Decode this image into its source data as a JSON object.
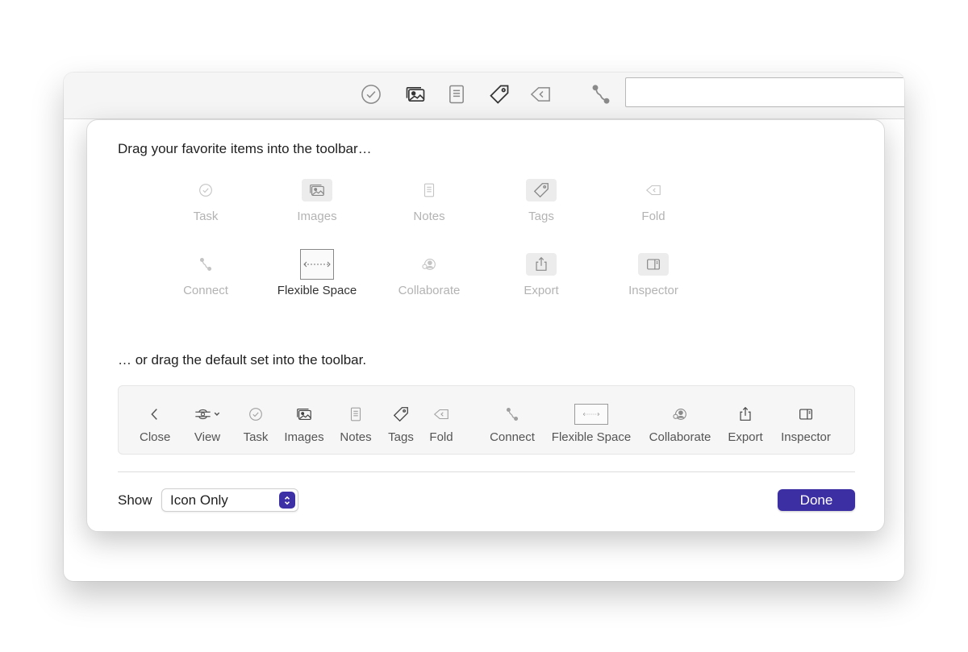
{
  "toolbar": {
    "icons": [
      "task-icon",
      "images-icon",
      "notes-icon",
      "tags-icon",
      "fold-icon",
      "connect-icon"
    ],
    "search_value": ""
  },
  "sheet": {
    "instruction_top": "Drag your favorite items into the toolbar…",
    "instruction_bottom": "… or drag the default set into the toolbar.",
    "palette": [
      {
        "label": "Task",
        "icon": "task-icon"
      },
      {
        "label": "Images",
        "icon": "images-icon"
      },
      {
        "label": "Notes",
        "icon": "notes-icon"
      },
      {
        "label": "Tags",
        "icon": "tags-icon"
      },
      {
        "label": "Fold",
        "icon": "fold-icon"
      },
      {
        "label": "Connect",
        "icon": "connect-icon"
      },
      {
        "label": "Flexible Space",
        "icon": "flexible-space-icon"
      },
      {
        "label": "Collaborate",
        "icon": "collaborate-icon"
      },
      {
        "label": "Export",
        "icon": "export-icon"
      },
      {
        "label": "Inspector",
        "icon": "inspector-icon"
      }
    ],
    "default_set": [
      {
        "label": "Close",
        "icon": "chevron-left-icon"
      },
      {
        "label": "View",
        "icon": "view-icon"
      },
      {
        "label": "Task",
        "icon": "task-icon"
      },
      {
        "label": "Images",
        "icon": "images-icon"
      },
      {
        "label": "Notes",
        "icon": "notes-icon"
      },
      {
        "label": "Tags",
        "icon": "tags-icon"
      },
      {
        "label": "Fold",
        "icon": "fold-icon"
      },
      {
        "label": "Connect",
        "icon": "connect-icon"
      },
      {
        "label": "Flexible Space",
        "icon": "flexible-space-icon"
      },
      {
        "label": "Collaborate",
        "icon": "collaborate-icon"
      },
      {
        "label": "Export",
        "icon": "export-icon"
      },
      {
        "label": "Inspector",
        "icon": "inspector-icon"
      }
    ],
    "show_label": "Show",
    "show_value": "Icon Only",
    "done_label": "Done"
  },
  "colors": {
    "accent": "#3c2ea3",
    "icon_inactive": "#b3b3b3",
    "icon_default": "#6a6a6a"
  }
}
